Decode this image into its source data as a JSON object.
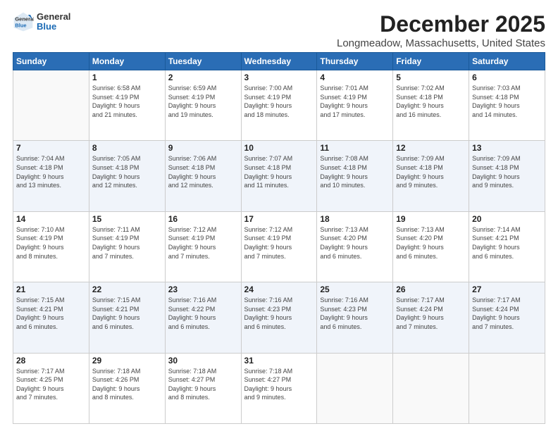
{
  "header": {
    "logo_general": "General",
    "logo_blue": "Blue",
    "month_title": "December 2025",
    "location": "Longmeadow, Massachusetts, United States"
  },
  "days_of_week": [
    "Sunday",
    "Monday",
    "Tuesday",
    "Wednesday",
    "Thursday",
    "Friday",
    "Saturday"
  ],
  "weeks": [
    [
      {
        "day": "",
        "info": ""
      },
      {
        "day": "1",
        "info": "Sunrise: 6:58 AM\nSunset: 4:19 PM\nDaylight: 9 hours\nand 21 minutes."
      },
      {
        "day": "2",
        "info": "Sunrise: 6:59 AM\nSunset: 4:19 PM\nDaylight: 9 hours\nand 19 minutes."
      },
      {
        "day": "3",
        "info": "Sunrise: 7:00 AM\nSunset: 4:19 PM\nDaylight: 9 hours\nand 18 minutes."
      },
      {
        "day": "4",
        "info": "Sunrise: 7:01 AM\nSunset: 4:19 PM\nDaylight: 9 hours\nand 17 minutes."
      },
      {
        "day": "5",
        "info": "Sunrise: 7:02 AM\nSunset: 4:18 PM\nDaylight: 9 hours\nand 16 minutes."
      },
      {
        "day": "6",
        "info": "Sunrise: 7:03 AM\nSunset: 4:18 PM\nDaylight: 9 hours\nand 14 minutes."
      }
    ],
    [
      {
        "day": "7",
        "info": "Sunrise: 7:04 AM\nSunset: 4:18 PM\nDaylight: 9 hours\nand 13 minutes."
      },
      {
        "day": "8",
        "info": "Sunrise: 7:05 AM\nSunset: 4:18 PM\nDaylight: 9 hours\nand 12 minutes."
      },
      {
        "day": "9",
        "info": "Sunrise: 7:06 AM\nSunset: 4:18 PM\nDaylight: 9 hours\nand 12 minutes."
      },
      {
        "day": "10",
        "info": "Sunrise: 7:07 AM\nSunset: 4:18 PM\nDaylight: 9 hours\nand 11 minutes."
      },
      {
        "day": "11",
        "info": "Sunrise: 7:08 AM\nSunset: 4:18 PM\nDaylight: 9 hours\nand 10 minutes."
      },
      {
        "day": "12",
        "info": "Sunrise: 7:09 AM\nSunset: 4:18 PM\nDaylight: 9 hours\nand 9 minutes."
      },
      {
        "day": "13",
        "info": "Sunrise: 7:09 AM\nSunset: 4:18 PM\nDaylight: 9 hours\nand 9 minutes."
      }
    ],
    [
      {
        "day": "14",
        "info": "Sunrise: 7:10 AM\nSunset: 4:19 PM\nDaylight: 9 hours\nand 8 minutes."
      },
      {
        "day": "15",
        "info": "Sunrise: 7:11 AM\nSunset: 4:19 PM\nDaylight: 9 hours\nand 7 minutes."
      },
      {
        "day": "16",
        "info": "Sunrise: 7:12 AM\nSunset: 4:19 PM\nDaylight: 9 hours\nand 7 minutes."
      },
      {
        "day": "17",
        "info": "Sunrise: 7:12 AM\nSunset: 4:19 PM\nDaylight: 9 hours\nand 7 minutes."
      },
      {
        "day": "18",
        "info": "Sunrise: 7:13 AM\nSunset: 4:20 PM\nDaylight: 9 hours\nand 6 minutes."
      },
      {
        "day": "19",
        "info": "Sunrise: 7:13 AM\nSunset: 4:20 PM\nDaylight: 9 hours\nand 6 minutes."
      },
      {
        "day": "20",
        "info": "Sunrise: 7:14 AM\nSunset: 4:21 PM\nDaylight: 9 hours\nand 6 minutes."
      }
    ],
    [
      {
        "day": "21",
        "info": "Sunrise: 7:15 AM\nSunset: 4:21 PM\nDaylight: 9 hours\nand 6 minutes."
      },
      {
        "day": "22",
        "info": "Sunrise: 7:15 AM\nSunset: 4:21 PM\nDaylight: 9 hours\nand 6 minutes."
      },
      {
        "day": "23",
        "info": "Sunrise: 7:16 AM\nSunset: 4:22 PM\nDaylight: 9 hours\nand 6 minutes."
      },
      {
        "day": "24",
        "info": "Sunrise: 7:16 AM\nSunset: 4:23 PM\nDaylight: 9 hours\nand 6 minutes."
      },
      {
        "day": "25",
        "info": "Sunrise: 7:16 AM\nSunset: 4:23 PM\nDaylight: 9 hours\nand 6 minutes."
      },
      {
        "day": "26",
        "info": "Sunrise: 7:17 AM\nSunset: 4:24 PM\nDaylight: 9 hours\nand 7 minutes."
      },
      {
        "day": "27",
        "info": "Sunrise: 7:17 AM\nSunset: 4:24 PM\nDaylight: 9 hours\nand 7 minutes."
      }
    ],
    [
      {
        "day": "28",
        "info": "Sunrise: 7:17 AM\nSunset: 4:25 PM\nDaylight: 9 hours\nand 7 minutes."
      },
      {
        "day": "29",
        "info": "Sunrise: 7:18 AM\nSunset: 4:26 PM\nDaylight: 9 hours\nand 8 minutes."
      },
      {
        "day": "30",
        "info": "Sunrise: 7:18 AM\nSunset: 4:27 PM\nDaylight: 9 hours\nand 8 minutes."
      },
      {
        "day": "31",
        "info": "Sunrise: 7:18 AM\nSunset: 4:27 PM\nDaylight: 9 hours\nand 9 minutes."
      },
      {
        "day": "",
        "info": ""
      },
      {
        "day": "",
        "info": ""
      },
      {
        "day": "",
        "info": ""
      }
    ]
  ]
}
